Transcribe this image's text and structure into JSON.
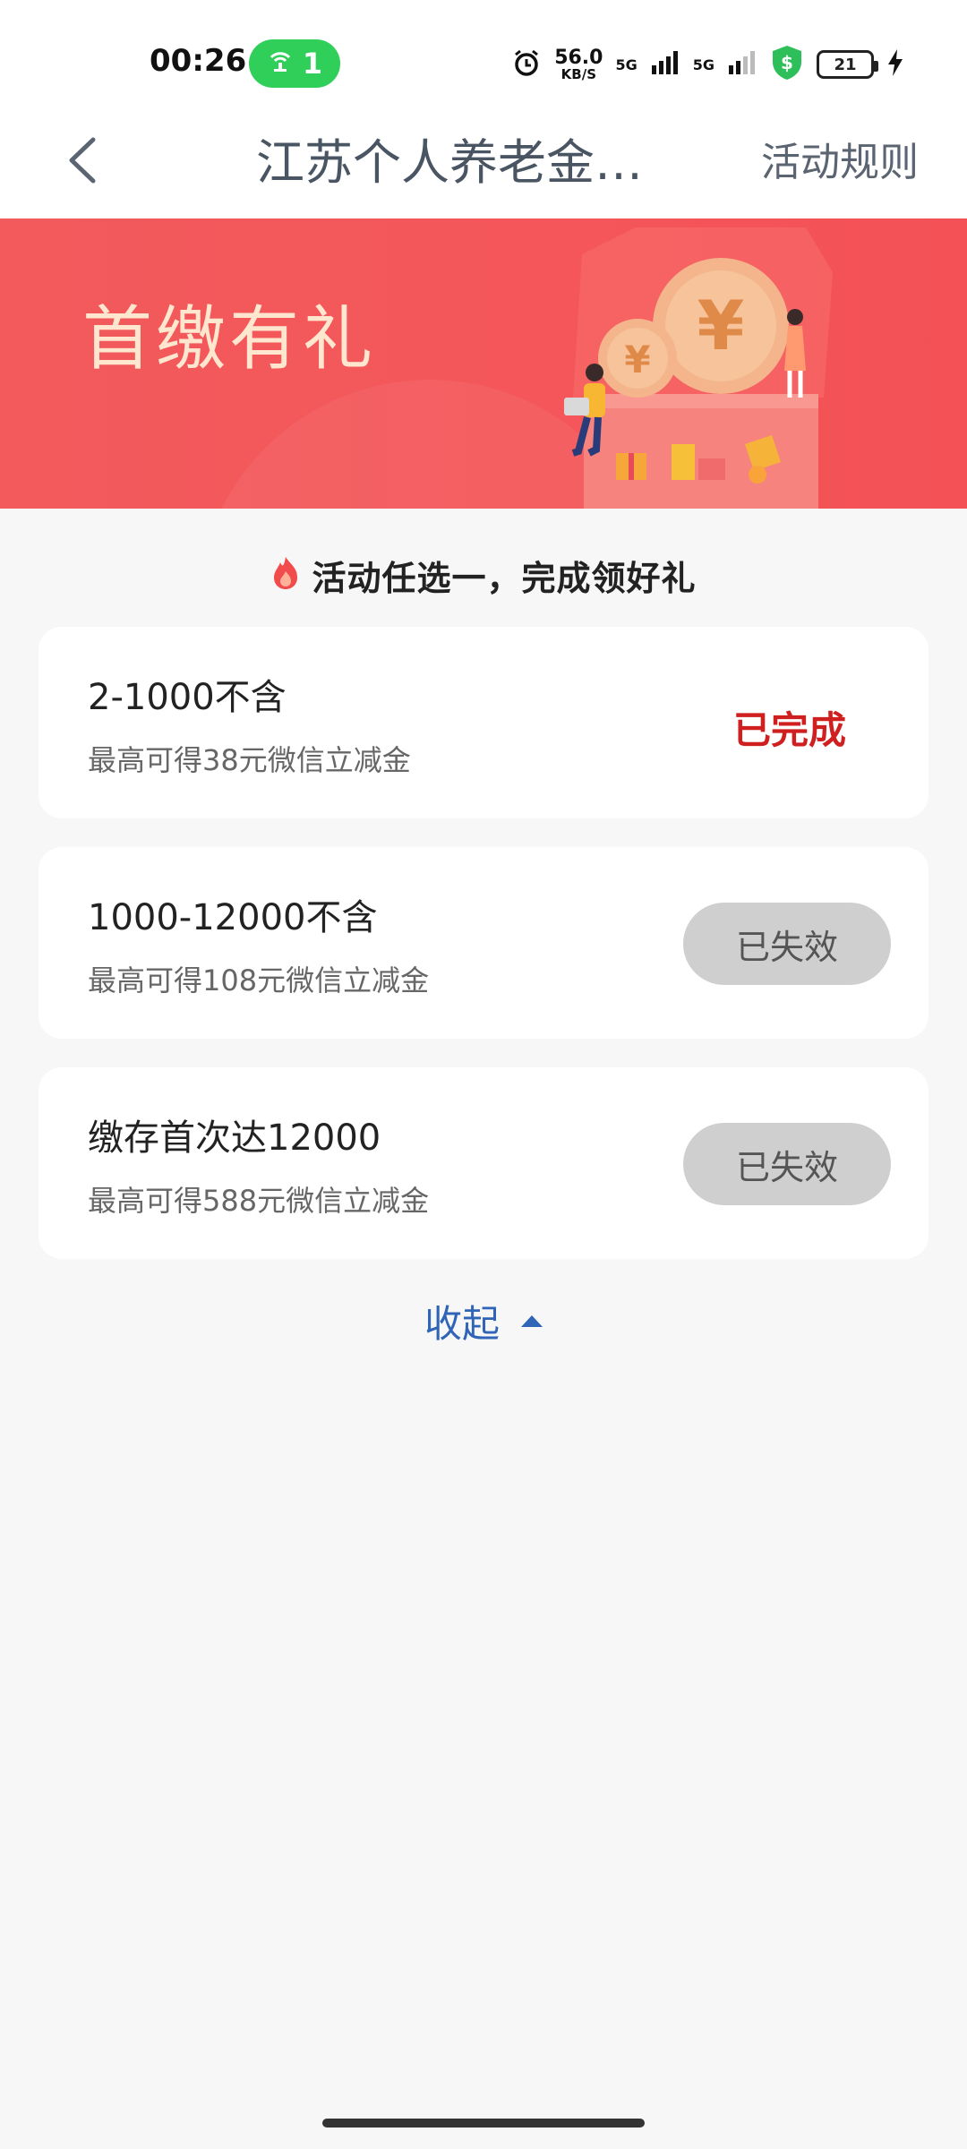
{
  "status_bar": {
    "time": "00:26",
    "hotspot_count": "1",
    "speed_value": "56.0",
    "speed_unit": "KB/S",
    "network_1": "5G",
    "network_2": "5G",
    "battery": "21"
  },
  "header": {
    "title": "江苏个人养老金首...",
    "rules": "活动规则"
  },
  "banner": {
    "title": "首缴有礼"
  },
  "tip": "活动任选一，完成领好礼",
  "tasks": [
    {
      "title": "2-1000不含",
      "subtitle": "最高可得38元微信立减金",
      "status": "已完成"
    },
    {
      "title": "1000-12000不含",
      "subtitle": "最高可得108元微信立减金",
      "status": "已失效"
    },
    {
      "title": "缴存首次达12000",
      "subtitle": "最高可得588元微信立减金",
      "status": "已失效"
    }
  ],
  "collapse": "收起",
  "colors": {
    "banner": "#f25a5c",
    "done": "#cf1f1f",
    "link": "#2f64b6",
    "hotspot": "#2fcf5a"
  }
}
